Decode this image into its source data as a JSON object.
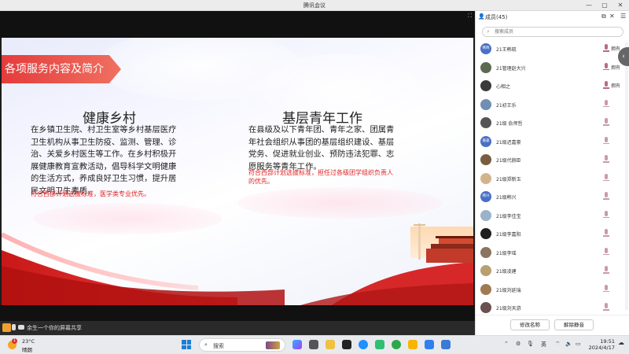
{
  "window": {
    "title": "腾讯会议",
    "controls": [
      "—",
      "▢",
      "✕"
    ]
  },
  "share": {
    "status_text": "余生一个你的屏幕共享"
  },
  "slide": {
    "tag": "各项服务内容及简介",
    "left_heading": "健康乡村",
    "left_body": [
      "在乡镇卫生院、村卫生室等乡村基层医疗",
      "卫生机构从事卫生防疫、监测、管理、诊",
      "治、关爱乡村医生等工作。在乡村积极开",
      "展健康教育宣教活动，倡导科学文明健康",
      "的生活方式，养成良好卫生习惯，提升居",
      "民文明卫生素质。"
    ],
    "left_note": "符合西部计划选拔标准，医学类专业优先。",
    "right_heading": "基层青年工作",
    "right_body": [
      "在县级及以下青年团、青年之家、团属青",
      "年社会组织从事团的基层组织建设、基层",
      "党务、促进就业创业、预防违法犯罪、志",
      "愿服务等青年工作。"
    ],
    "right_note": [
      "符合西部计划选拔标准，担任过各级团学组织负责人",
      "的优先。"
    ]
  },
  "panel": {
    "title": "成员(45)",
    "search_placeholder": "搜索成员",
    "members": [
      {
        "avatar_text": "韩晓",
        "name": "21王韩晓",
        "role": "拥有",
        "avatar_color": "#4a6fc6",
        "mic_dim": false
      },
      {
        "avatar_text": "",
        "name": "21管理赵大兴",
        "role": "拥有",
        "avatar_color": "#5d6a52",
        "mic_dim": false
      },
      {
        "avatar_text": "",
        "name": "心相之",
        "role": "拥有",
        "avatar_color": "#3a3a3a",
        "mic_dim": false
      },
      {
        "avatar_text": "",
        "name": "21初王乐",
        "role": "",
        "avatar_color": "#6f8fb3",
        "mic_dim": true
      },
      {
        "avatar_text": "",
        "name": "21级 俞师哲",
        "role": "",
        "avatar_color": "#555",
        "mic_dim": true
      },
      {
        "avatar_text": "嘉豪",
        "name": "21级迟嘉豪",
        "role": "",
        "avatar_color": "#4a6fc6",
        "mic_dim": true
      },
      {
        "avatar_text": "",
        "name": "21级代赫臣",
        "role": "",
        "avatar_color": "#7a5c3e",
        "mic_dim": true
      },
      {
        "avatar_text": "",
        "name": "21级郑新玉",
        "role": "",
        "avatar_color": "#d2b48c",
        "mic_dim": true
      },
      {
        "avatar_text": "韩兴",
        "name": "21级韩兴",
        "role": "",
        "avatar_color": "#4a6fc6",
        "mic_dim": true
      },
      {
        "avatar_text": "",
        "name": "21级李佳宝",
        "role": "",
        "avatar_color": "#9bb2c9",
        "mic_dim": true
      },
      {
        "avatar_text": "",
        "name": "21级李嘉阳",
        "role": "",
        "avatar_color": "#1f1f1f",
        "mic_dim": true
      },
      {
        "avatar_text": "",
        "name": "21级李瑶",
        "role": "",
        "avatar_color": "#8a7560",
        "mic_dim": true
      },
      {
        "avatar_text": "",
        "name": "21级凌建",
        "role": "",
        "avatar_color": "#b8a070",
        "mic_dim": true
      },
      {
        "avatar_text": "",
        "name": "21级刘延瑞",
        "role": "",
        "avatar_color": "#a07a50",
        "mic_dim": true
      },
      {
        "avatar_text": "",
        "name": "21级刘天游",
        "role": "",
        "avatar_color": "#6a5050",
        "mic_dim": true
      }
    ],
    "rename_button": "修改名称",
    "unmute_button": "解除静音"
  },
  "taskbar": {
    "weather_badge": "1",
    "temperature": "23°C",
    "condition": "晴朗",
    "search_label": "搜索",
    "ime": "英",
    "time": "19:51",
    "date": "2024/4/17"
  },
  "colors": {
    "accent_red": "#e43c3c",
    "note_red": "#e02020",
    "avatar_blue": "#4a6fc6"
  }
}
